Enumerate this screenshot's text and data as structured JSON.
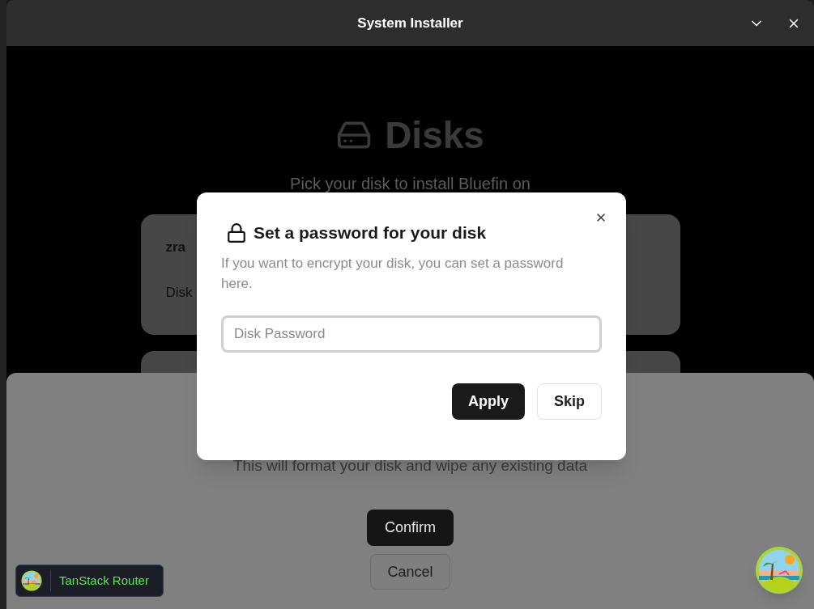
{
  "window": {
    "title": "System Installer"
  },
  "page": {
    "heading": "Disks",
    "subtitle": "Pick your disk to install Bluefin on"
  },
  "disk_cards": [
    {
      "name": "zra",
      "detail": "Disk"
    }
  ],
  "confirm_sheet": {
    "warning": "This will format your disk and wipe any existing data",
    "buttons": [
      {
        "label": "Confirm",
        "kind": "primary"
      },
      {
        "label": "Cancel",
        "kind": "secondary"
      }
    ]
  },
  "dialog": {
    "title": "Set a password for your disk",
    "description": "If you want to encrypt your disk, you can set a password here.",
    "password_field": {
      "placeholder": "Disk Password"
    },
    "buttons": [
      {
        "label": "Apply",
        "kind": "primary"
      },
      {
        "label": "Skip",
        "kind": "secondary"
      }
    ]
  },
  "devtools": {
    "label": "TanStack Router"
  }
}
